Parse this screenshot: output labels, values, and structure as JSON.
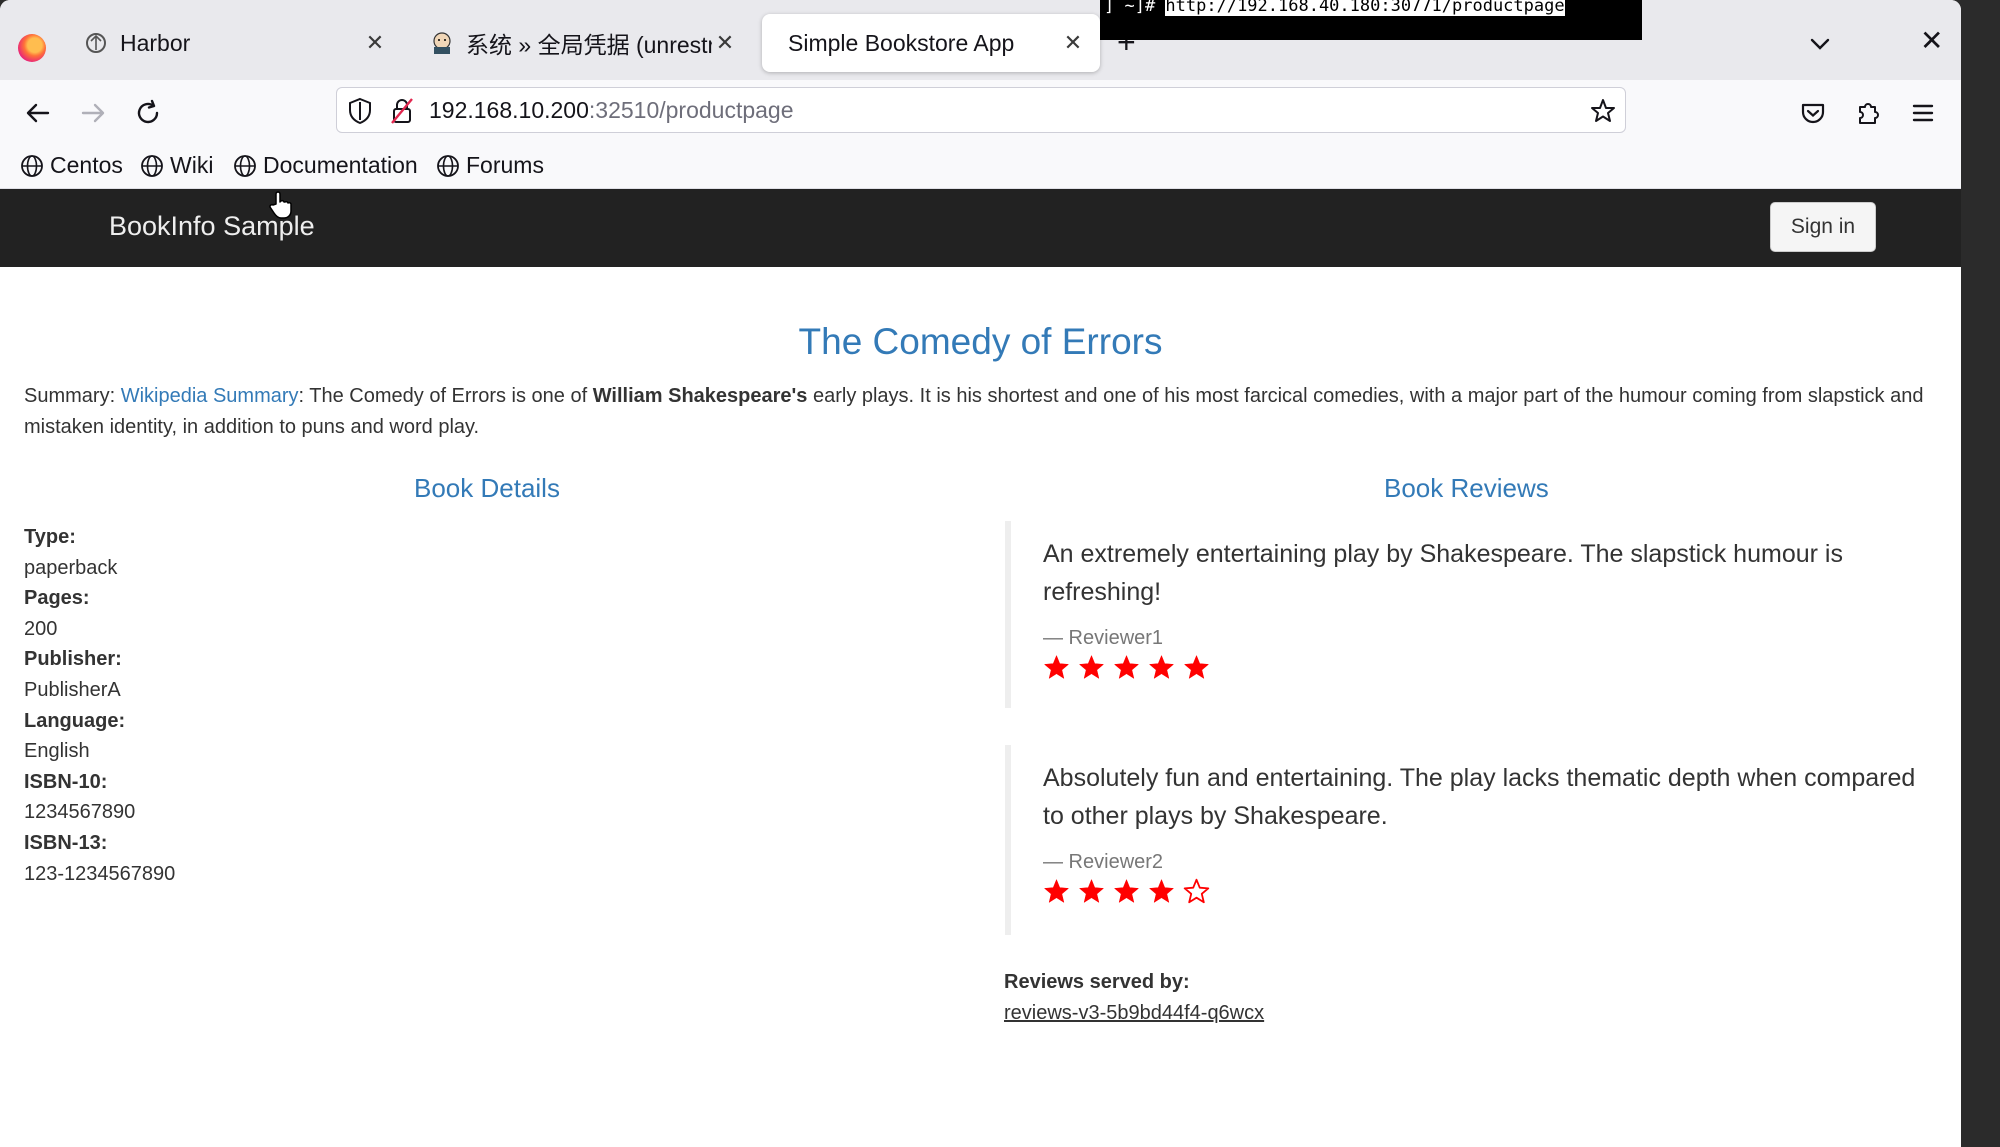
{
  "browser": {
    "tabs": [
      {
        "title": "Harbor",
        "close": "✕",
        "active": false
      },
      {
        "title": "系统 » 全局凭据 (unrestricted)",
        "close": "✕",
        "active": false
      },
      {
        "title": "Simple Bookstore App",
        "close": "✕",
        "active": true
      }
    ],
    "new_tab": "+",
    "window_close": "✕",
    "url": {
      "host": "192.168.10.200",
      "path": ":32510/productpage"
    },
    "bookmarks": [
      "Centos",
      "Wiki",
      "Documentation",
      "Forums"
    ]
  },
  "terminal": {
    "prompt": "] ~]# ",
    "command": "http://192.168.40.180:30771/productpage"
  },
  "site": {
    "brand": "BookInfo Sample",
    "signin": "Sign in"
  },
  "book": {
    "title": "The Comedy of Errors",
    "summary_prefix": "Summary: ",
    "summary_link": "Wikipedia Summary",
    "summary_mid": ": The Comedy of Errors is one of ",
    "summary_bold": "William Shakespeare's",
    "summary_rest": " early plays. It is his shortest and one of his most farcical comedies, with a major part of the humour coming from slapstick and mistaken identity, in addition to puns and word play."
  },
  "details": {
    "heading": "Book Details",
    "items": [
      {
        "label": "Type:",
        "value": "paperback"
      },
      {
        "label": "Pages:",
        "value": "200"
      },
      {
        "label": "Publisher:",
        "value": "PublisherA"
      },
      {
        "label": "Language:",
        "value": "English"
      },
      {
        "label": "ISBN-10:",
        "value": "1234567890"
      },
      {
        "label": "ISBN-13:",
        "value": "123-1234567890"
      }
    ]
  },
  "reviews": {
    "heading": "Book Reviews",
    "items": [
      {
        "text": "An extremely entertaining play by Shakespeare. The slapstick humour is refreshing!",
        "reviewer": "— Reviewer1",
        "rating": 5,
        "star_color": "#ff0000"
      },
      {
        "text": "Absolutely fun and entertaining. The play lacks thematic depth when compared to other plays by Shakespeare.",
        "reviewer": "— Reviewer2",
        "rating": 4,
        "star_color": "#ff0000"
      }
    ],
    "served_by_label": "Reviews served by:",
    "served_by_pod": "reviews-v3-5b9bd44f4-q6wcx"
  },
  "icons": [
    "firefox-logo-icon",
    "harbor-icon",
    "jenkins-icon",
    "back-icon",
    "forward-icon",
    "reload-icon",
    "shield-icon",
    "insecure-lock-icon",
    "star-bookmark-icon",
    "pocket-icon",
    "extensions-icon",
    "menu-icon",
    "globe-icon",
    "list-all-tabs-icon",
    "mouse-cursor-icon"
  ]
}
